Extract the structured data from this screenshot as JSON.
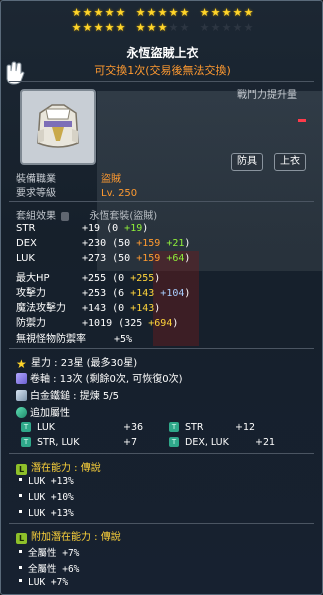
{
  "stars": {
    "filled": 23,
    "total": 30
  },
  "item": {
    "name": "永恆盜賊上衣",
    "trade": "可交換1次(交易後無法交換)",
    "cp_label": "戰鬥力提升量",
    "cp_value": "-",
    "badges": [
      "防具",
      "上衣"
    ]
  },
  "info": {
    "job_label": "裝備職業",
    "job_value": "盜賊",
    "level_label": "要求等級",
    "level_value": "Lv. 250",
    "set_label": "套組效果",
    "set_value": "永恆套裝(盜賊)"
  },
  "stats": [
    {
      "key": "STR",
      "total": "+19",
      "breakdown": [
        {
          "t": "(0 ",
          "c": "white"
        },
        {
          "t": "+19",
          "c": "green"
        },
        {
          "t": ")",
          "c": "white"
        }
      ]
    },
    {
      "key": "DEX",
      "total": "+230",
      "breakdown": [
        {
          "t": "(50 ",
          "c": "white"
        },
        {
          "t": "+159",
          "c": "orange"
        },
        {
          "t": " +21",
          "c": "green"
        },
        {
          "t": ")",
          "c": "white"
        }
      ]
    },
    {
      "key": "LUK",
      "total": "+273",
      "breakdown": [
        {
          "t": "(50 ",
          "c": "white"
        },
        {
          "t": "+159",
          "c": "orange"
        },
        {
          "t": " +64",
          "c": "green"
        },
        {
          "t": ")",
          "c": "white"
        }
      ]
    },
    {
      "key": "最大HP",
      "total": "+255",
      "breakdown": [
        {
          "t": "(0 ",
          "c": "white"
        },
        {
          "t": "+255",
          "c": "yellow"
        },
        {
          "t": ")",
          "c": "white"
        }
      ]
    },
    {
      "key": "攻擊力",
      "total": "+253",
      "breakdown": [
        {
          "t": "(6 ",
          "c": "white"
        },
        {
          "t": "+143",
          "c": "yellow"
        },
        {
          "t": " +104",
          "c": "lblue"
        },
        {
          "t": ")",
          "c": "white"
        }
      ]
    },
    {
      "key": "魔法攻擊力",
      "total": "+143",
      "breakdown": [
        {
          "t": "(0 ",
          "c": "white"
        },
        {
          "t": "+143",
          "c": "yellow"
        },
        {
          "t": ")",
          "c": "white"
        }
      ]
    },
    {
      "key": "防禦力",
      "total": "+1019",
      "breakdown": [
        {
          "t": "(325 ",
          "c": "white"
        },
        {
          "t": "+694",
          "c": "yellow"
        },
        {
          "t": ")",
          "c": "white"
        }
      ]
    },
    {
      "key": "無視怪物防禦率",
      "total": "+5%",
      "breakdown": []
    }
  ],
  "enhance": {
    "star_line": "星力 : 23星 (最多30星)",
    "scroll_line": "卷軸 : 13次 (剩餘0次, 可恢復0次)",
    "hammer_line": "白金鐵鎚 : 提煉 5/5",
    "add_label": "追加屬性",
    "add_stats": [
      {
        "label": "LUK",
        "value": "+36"
      },
      {
        "label": "STR",
        "value": "+12"
      },
      {
        "label": "STR, LUK",
        "value": "+7"
      },
      {
        "label": "DEX, LUK",
        "value": "+21"
      }
    ]
  },
  "potential": {
    "head_label": "潛在能力",
    "grade": "傳說",
    "lines": [
      "LUK +13%",
      "LUK +10%",
      "LUK +13%"
    ]
  },
  "bonus_potential": {
    "head_label": "附加潛在能力",
    "grade": "傳說",
    "lines": [
      "全屬性 +7%",
      "全屬性 +6%",
      "LUK +7%"
    ]
  }
}
